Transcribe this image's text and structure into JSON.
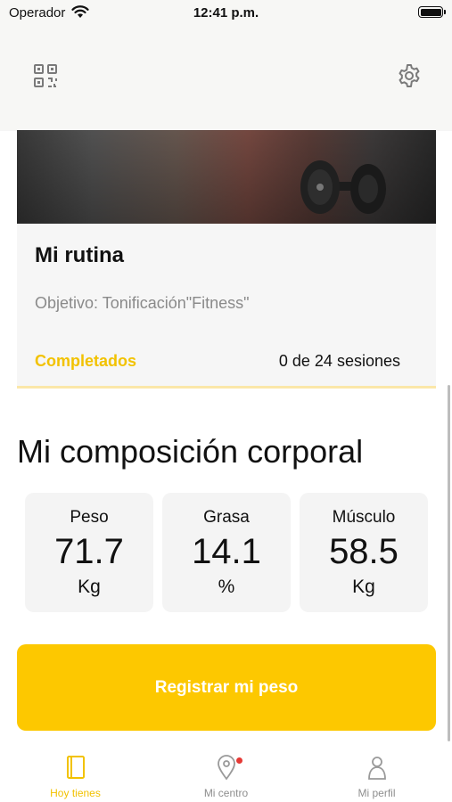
{
  "status_bar": {
    "carrier": "Operador",
    "time": "12:41 p.m."
  },
  "top_bar": {
    "left_icon": "qr-code-icon",
    "right_icon": "gear-icon"
  },
  "routine": {
    "title": "Mi rutina",
    "objective": "Objetivo: Tonificación\"Fitness\"",
    "completed_label": "Completados",
    "sessions": "0 de 24 sesiones"
  },
  "composition": {
    "title": "Mi composición corporal",
    "metrics": [
      {
        "label": "Peso",
        "value": "71.7",
        "unit": "Kg"
      },
      {
        "label": "Grasa",
        "value": "14.1",
        "unit": "%"
      },
      {
        "label": "Músculo",
        "value": "58.5",
        "unit": "Kg"
      }
    ]
  },
  "register_button": {
    "label": "Registrar mi peso"
  },
  "tab_bar": {
    "tabs": [
      {
        "label": "Hoy tienes",
        "icon": "book-icon",
        "active": true
      },
      {
        "label": "Mi centro",
        "icon": "location-pin-icon",
        "active": false,
        "badge": true
      },
      {
        "label": "Mi perfil",
        "icon": "person-icon",
        "active": false
      }
    ]
  },
  "colors": {
    "accent": "#fdc800",
    "accent_text": "#f2c200",
    "badge": "#e53935",
    "muted_text": "#8a8a8a"
  }
}
